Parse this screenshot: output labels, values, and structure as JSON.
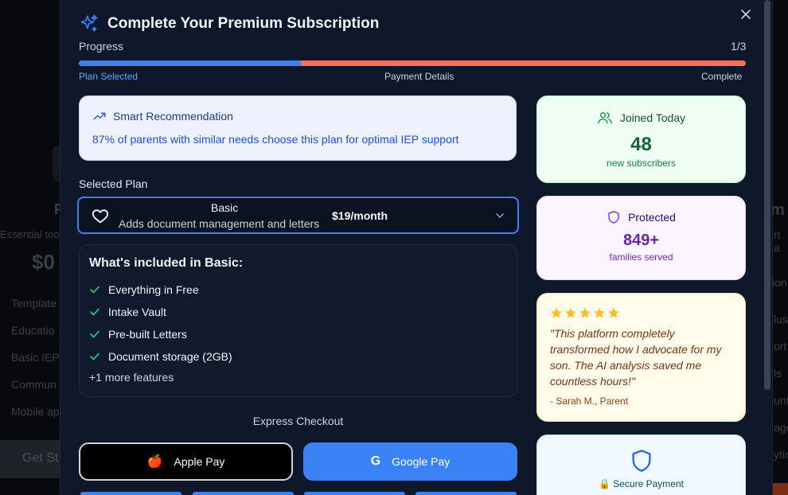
{
  "background": {
    "texts": [
      "Essential too",
      "Template",
      "Educatio",
      "Basic IEP",
      "Commun",
      "Mobile ap"
    ],
    "price": "$0",
    "button": "Get St",
    "right_texts": [
      "m",
      "rt a",
      "ion",
      "lus",
      "ort",
      "ls",
      "unt",
      "age",
      "ytic"
    ],
    "letter_f": "F"
  },
  "modal": {
    "title": "Complete Your Premium Subscription",
    "progress_label": "Progress",
    "progress_count": "1/3",
    "progress_fraction": 0.333,
    "steps": [
      "Plan Selected",
      "Payment Details",
      "Complete"
    ]
  },
  "recommendation": {
    "heading": "Smart Recommendation",
    "body": "87% of parents with similar needs choose this plan for optimal IEP support"
  },
  "plan": {
    "label": "Selected Plan",
    "name": "Basic",
    "description": "Adds document management and letters",
    "price": "$19/month"
  },
  "included": {
    "title": "What's included in Basic:",
    "items": [
      "Everything in Free",
      "Intake Vault",
      "Pre-built Letters",
      "Document storage (2GB)"
    ],
    "more": "+1 more features"
  },
  "checkout": {
    "label": "Express Checkout",
    "apple": "Apple Pay",
    "google": "Google Pay",
    "google_glyph": "G",
    "apple_glyph": "🍎"
  },
  "stats": {
    "joined_heading": "Joined Today",
    "joined_value": "48",
    "joined_sub": "new subscribers",
    "protected_heading": "Protected",
    "protected_value": "849+",
    "protected_sub": "families served"
  },
  "testimonial": {
    "rating": 5,
    "quote": "\"This platform completely transformed how I advocate for my son. The AI analysis saved me countless hours!\"",
    "author": "- Sarah M., Parent"
  },
  "secure": {
    "label": "🔒 Secure Payment"
  },
  "colors": {
    "accent": "#3b82f6",
    "remaining": "#fb7151",
    "success": "#22c55e",
    "star": "#fbbf24"
  }
}
